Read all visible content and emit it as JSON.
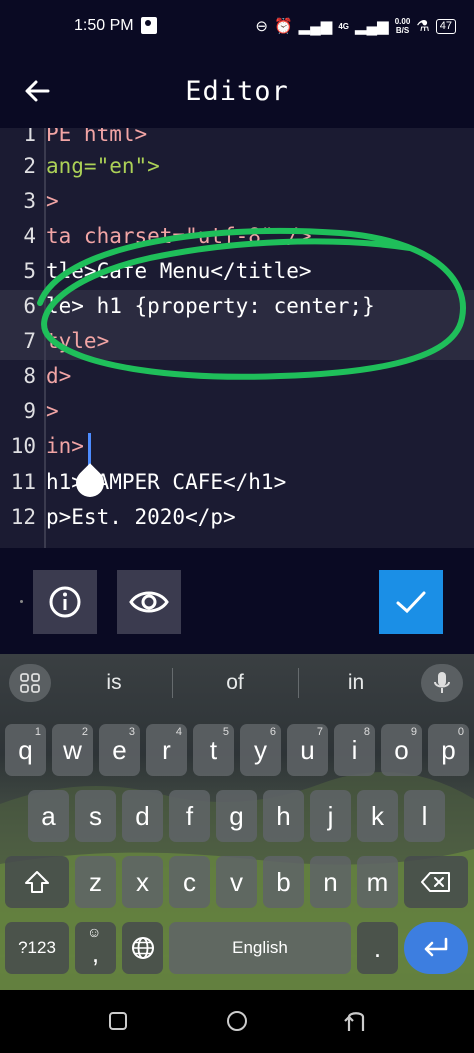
{
  "status_bar": {
    "time": "1:50 PM",
    "network": "4G",
    "data_rate_top": "0.00",
    "data_rate_bottom": "B/S",
    "battery": "47"
  },
  "app_bar": {
    "title": "Editor"
  },
  "editor": {
    "lines": [
      {
        "num": "1",
        "text": "PE html>"
      },
      {
        "num": "2",
        "text": "ang=\"en\">"
      },
      {
        "num": "3",
        "text": ">"
      },
      {
        "num": "4",
        "text": "ta charset=\"utf-8\" />"
      },
      {
        "num": "5",
        "text": "tle>Cafe Menu</title>"
      },
      {
        "num": "6",
        "text": "le> h1 {property: center;}"
      },
      {
        "num": "7",
        "text": "tyle>"
      },
      {
        "num": "8",
        "text": "d>"
      },
      {
        "num": "9",
        "text": ">"
      },
      {
        "num": "10",
        "text": "in>"
      },
      {
        "num": "11",
        "text": "h1>CAMPER CAFE</h1>"
      },
      {
        "num": "12",
        "text": "p>Est. 2020</p>"
      }
    ],
    "highlight_color": "#1fbf5a"
  },
  "toolbar": {
    "info_icon": "info-icon",
    "preview_icon": "eye-icon",
    "submit_icon": "check-icon",
    "submit_color": "#1b8fe6"
  },
  "keyboard": {
    "suggestions": [
      "is",
      "of",
      "in"
    ],
    "row1": [
      {
        "k": "q",
        "h": "1"
      },
      {
        "k": "w",
        "h": "2"
      },
      {
        "k": "e",
        "h": "3"
      },
      {
        "k": "r",
        "h": "4"
      },
      {
        "k": "t",
        "h": "5"
      },
      {
        "k": "y",
        "h": "6"
      },
      {
        "k": "u",
        "h": "7"
      },
      {
        "k": "i",
        "h": "8"
      },
      {
        "k": "o",
        "h": "9"
      },
      {
        "k": "p",
        "h": "0"
      }
    ],
    "row2": [
      "a",
      "s",
      "d",
      "f",
      "g",
      "h",
      "j",
      "k",
      "l"
    ],
    "row3": [
      "z",
      "x",
      "c",
      "v",
      "b",
      "n",
      "m"
    ],
    "symbols_label": "?123",
    "space_label": "English",
    "comma": ",",
    "period": "."
  }
}
